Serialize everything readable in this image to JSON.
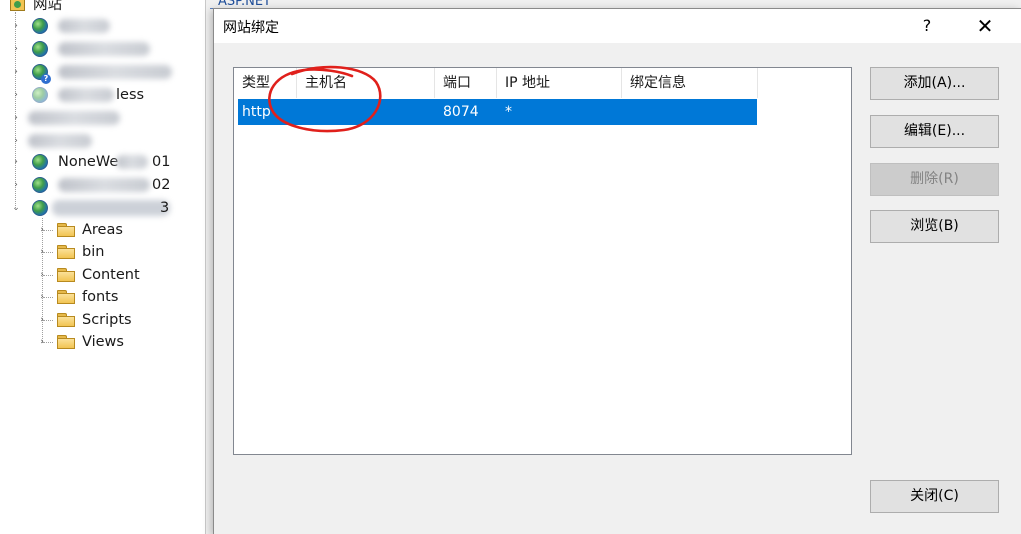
{
  "tree": {
    "root_label": "网站",
    "sites": [
      {
        "label": "NoneWe",
        "suffix": "01"
      },
      {
        "label": "",
        "suffix": "02"
      },
      {
        "label": "",
        "suffix": "3"
      }
    ],
    "partial_label_less": "less",
    "folders": [
      "Areas",
      "bin",
      "Content",
      "fonts",
      "Scripts",
      "Views"
    ]
  },
  "background": {
    "tab_label": "ASP.NET"
  },
  "dialog": {
    "title": "网站绑定",
    "help_glyph": "?",
    "close_glyph": "✕",
    "columns": [
      "类型",
      "主机名",
      "端口",
      "IP 地址",
      "绑定信息"
    ],
    "rows": [
      {
        "type": "http",
        "host": "",
        "port": "8074",
        "ip": "*",
        "binding": ""
      }
    ],
    "buttons": {
      "add": "添加(A)...",
      "edit": "编辑(E)...",
      "remove": "删除(R)",
      "browse": "浏览(B)",
      "close": "关闭(C)"
    }
  },
  "colors": {
    "selection": "#0078d7",
    "annotation": "#e0201b"
  }
}
